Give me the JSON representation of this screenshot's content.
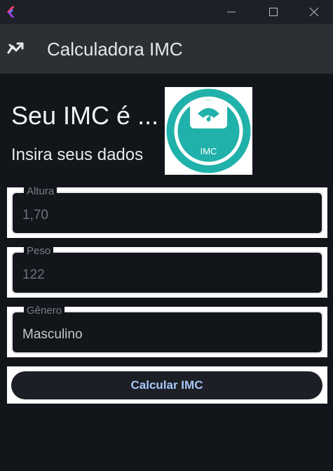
{
  "window": {
    "title_icon": "flutter-logo-icon"
  },
  "appbar": {
    "icon": "trending-icon",
    "title": "Calculadora IMC"
  },
  "main": {
    "heading": "Seu IMC é ...",
    "subheading": "Insira seus dados",
    "image_text": "IMC"
  },
  "form": {
    "altura": {
      "label": "Altura",
      "value": "1,70"
    },
    "peso": {
      "label": "Peso",
      "value": "122"
    },
    "genero": {
      "label": "Gênero",
      "value": "Masculino"
    }
  },
  "actions": {
    "calculate_label": "Calcular IMC"
  },
  "colors": {
    "accent": "#a9c6f7",
    "teal": "#20b2aa",
    "background": "#12151a"
  }
}
